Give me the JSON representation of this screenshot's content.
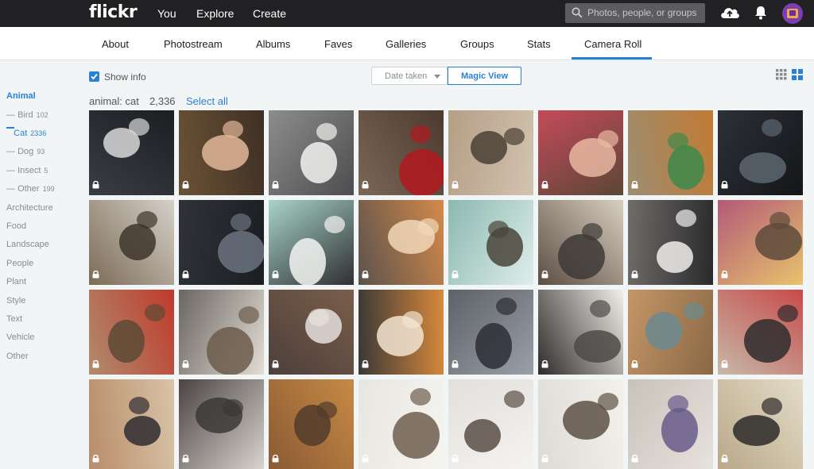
{
  "header": {
    "logo": "flickr",
    "nav": [
      "You",
      "Explore",
      "Create"
    ],
    "search_placeholder": "Photos, people, or groups"
  },
  "subnav": {
    "tabs": [
      "About",
      "Photostream",
      "Albums",
      "Faves",
      "Galleries",
      "Groups",
      "Stats",
      "Camera Roll"
    ],
    "active": "Camera Roll"
  },
  "sidebar": {
    "heading": "Animal",
    "sub_items": [
      {
        "label": "Bird",
        "count": "102"
      },
      {
        "label": "Cat",
        "count": "2336"
      },
      {
        "label": "Dog",
        "count": "93"
      },
      {
        "label": "Insect",
        "count": "5"
      },
      {
        "label": "Other",
        "count": "199"
      }
    ],
    "items": [
      "Architecture",
      "Food",
      "Landscape",
      "People",
      "Plant",
      "Style",
      "Text",
      "Vehicle",
      "Other"
    ]
  },
  "toolbar": {
    "show_info": "Show info",
    "show_info_checked": true,
    "sort_label": "Date taken",
    "magic_view": "Magic View"
  },
  "section": {
    "title": "animal: cat",
    "count": "2,336",
    "select_all": "Select all"
  },
  "colors": {
    "accent": "#2a80d4",
    "topbar": "#212124"
  },
  "photos": [
    {
      "bg": "#3a3d44",
      "blob": "#d8d8d8",
      "alt": "#1c1e22"
    },
    {
      "bg": "#6b5236",
      "blob": "#e2b79a",
      "alt": "#3e3024"
    },
    {
      "bg": "#8d8d8d",
      "blob": "#f2f2f0",
      "alt": "#4d4d4f"
    },
    {
      "bg": "#7a6757",
      "blob": "#b3181f",
      "alt": "#4b3a2e"
    },
    {
      "bg": "#b59e86",
      "blob": "#4a3f35",
      "alt": "#d2c3b0"
    },
    {
      "bg": "#c54a5c",
      "blob": "#e9b9a1",
      "alt": "#5b4636"
    },
    {
      "bg": "#9c8e72",
      "blob": "#3d8a4a",
      "alt": "#c27a33"
    },
    {
      "bg": "#2c3138",
      "blob": "#5d6670",
      "alt": "#141618"
    },
    {
      "bg": "#7b6b56",
      "blob": "#3d352c",
      "alt": "#d6d0c8"
    },
    {
      "bg": "#2f3338",
      "blob": "#6b7380",
      "alt": "#1b1d21"
    },
    {
      "bg": "#a7d3c9",
      "blob": "#f4f4f2",
      "alt": "#2f2f30"
    },
    {
      "bg": "#5b524c",
      "blob": "#f1d8b8",
      "alt": "#d58a4a"
    },
    {
      "bg": "#8bb8b0",
      "blob": "#4a4439",
      "alt": "#dfeeea"
    },
    {
      "bg": "#5a4e43",
      "blob": "#3d3a36",
      "alt": "#d9cfbf"
    },
    {
      "bg": "#6f6c69",
      "blob": "#f0efec",
      "alt": "#2a2a2c"
    },
    {
      "bg": "#b25a78",
      "blob": "#5c4a3b",
      "alt": "#e8c36c"
    },
    {
      "bg": "#b08c6e",
      "blob": "#5c4a35",
      "alt": "#c0392b"
    },
    {
      "bg": "#6a6660",
      "blob": "#6c5c4b",
      "alt": "#e3ddd4"
    },
    {
      "bg": "#4c3f3c",
      "blob": "#e5e1dc",
      "alt": "#7a5e4a"
    },
    {
      "bg": "#3a3836",
      "blob": "#f2e4d2",
      "alt": "#d9893c"
    },
    {
      "bg": "#5d6168",
      "blob": "#2c2e31",
      "alt": "#9aa0a8"
    },
    {
      "bg": "#2d2a29",
      "blob": "#4e4a47",
      "alt": "#f1efe9"
    },
    {
      "bg": "#c49668",
      "blob": "#6b8a8f",
      "alt": "#8a6844"
    },
    {
      "bg": "#c6b9a8",
      "blob": "#2e2c2e",
      "alt": "#c84a4a"
    },
    {
      "bg": "#b88d6a",
      "blob": "#2f2c30",
      "alt": "#d9c3a7"
    },
    {
      "bg": "#4a4343",
      "blob": "#3b3837",
      "alt": "#d9d4cf"
    },
    {
      "bg": "#8a5a34",
      "blob": "#513c2b",
      "alt": "#c78a45"
    },
    {
      "bg": "#e8e6e1",
      "blob": "#6d5e4e",
      "alt": "#f6f4ef"
    },
    {
      "bg": "#e2e0dc",
      "blob": "#5a4e45",
      "alt": "#f4f3f1"
    },
    {
      "bg": "#dedbd5",
      "blob": "#5e5146",
      "alt": "#f3f1ec"
    },
    {
      "bg": "#c8c2ba",
      "blob": "#675a8a",
      "alt": "#e6e2dc"
    },
    {
      "bg": "#b9a889",
      "blob": "#2c2a29",
      "alt": "#e4dcc8"
    }
  ]
}
